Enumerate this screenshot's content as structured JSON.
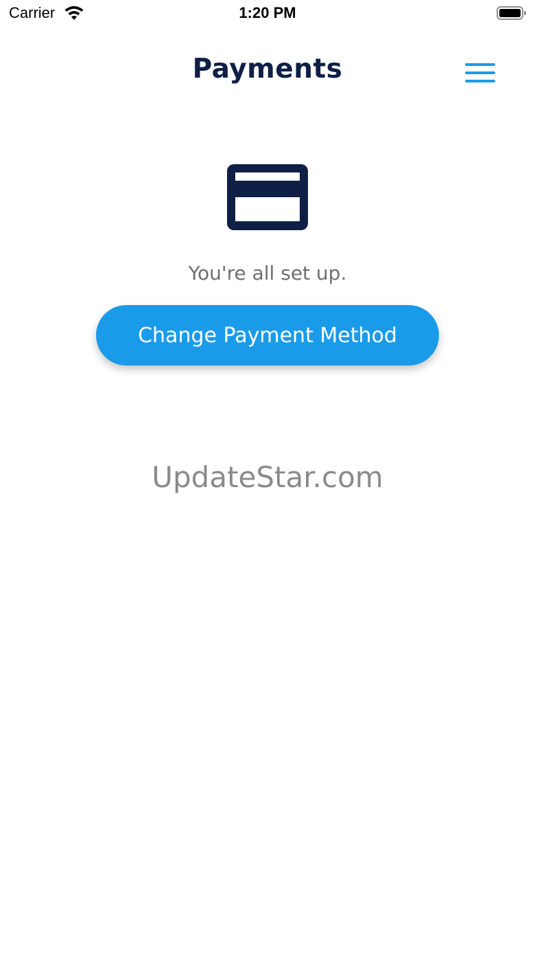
{
  "status_bar": {
    "carrier": "Carrier",
    "time": "1:20 PM",
    "icons": [
      "wifi-icon",
      "battery-icon"
    ]
  },
  "header": {
    "title": "Payments",
    "menu_icon": "hamburger-menu-icon"
  },
  "main": {
    "icon": "credit-card-icon",
    "status_text": "You're all set up.",
    "change_button_label": "Change Payment Method"
  },
  "watermark": "UpdateStar.com",
  "colors": {
    "accent": "#1a9bea",
    "title": "#0f1f45",
    "body_text": "#6e6e6e",
    "watermark": "#8a8a8a"
  }
}
